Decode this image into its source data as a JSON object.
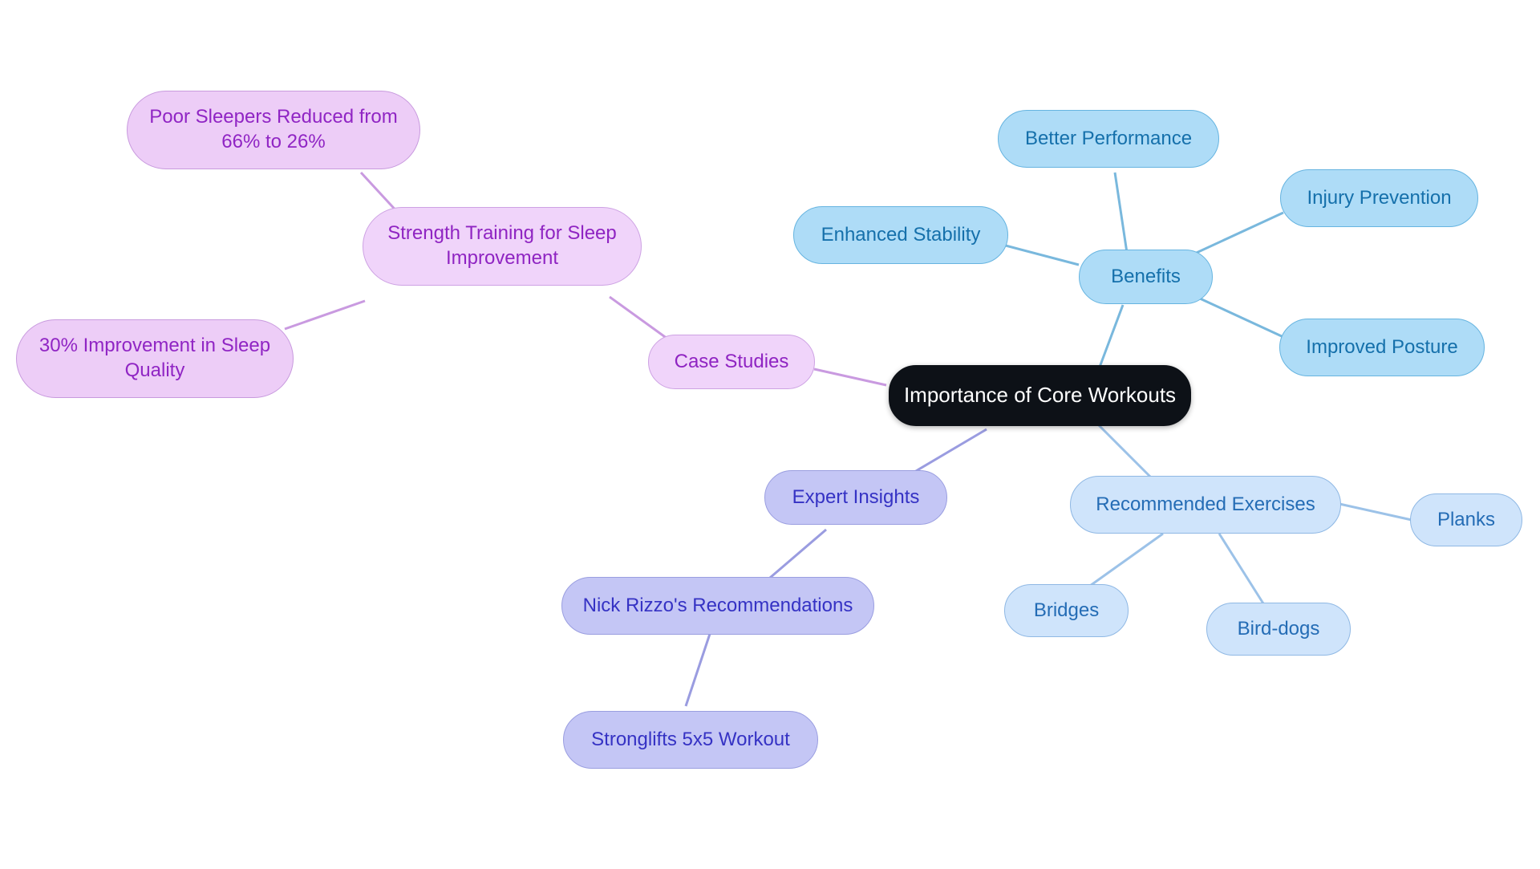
{
  "diagram": {
    "type": "mindmap",
    "title": "Importance of Core Workouts",
    "background": "#ffffff"
  },
  "palette": {
    "root_fill": "#0d1117",
    "root_text": "#ffffff",
    "purple_fill": "#edcdf7",
    "purple_text": "#9025c4",
    "blue_fill": "#aedcf7",
    "blue_text": "#1570ab",
    "blue_pale_fill": "#cfe4fb",
    "blue_pale_text": "#246cb5",
    "indigo_fill": "#c4c6f5",
    "indigo_text": "#3532c4",
    "edge_purple": "#c99ae0",
    "edge_blue": "#79b8dd",
    "edge_blue_pale": "#9cc2e8",
    "edge_indigo": "#9a9ce0"
  },
  "nodes": {
    "root": {
      "label": "Importance of Core Workouts"
    },
    "benefits": {
      "label": "Benefits"
    },
    "better_performance": {
      "label": "Better Performance"
    },
    "enhanced_stability": {
      "label": "Enhanced Stability"
    },
    "injury_prevention": {
      "label": "Injury Prevention"
    },
    "improved_posture": {
      "label": "Improved Posture"
    },
    "recommended_exercises": {
      "label": "Recommended Exercises"
    },
    "planks": {
      "label": "Planks"
    },
    "bridges": {
      "label": "Bridges"
    },
    "bird_dogs": {
      "label": "Bird-dogs"
    },
    "expert_insights": {
      "label": "Expert Insights"
    },
    "nick_rizzo": {
      "label": "Nick Rizzo's Recommendations"
    },
    "stronglifts": {
      "label": "Stronglifts 5x5 Workout"
    },
    "case_studies": {
      "label": "Case Studies"
    },
    "strength_training": {
      "label": "Strength Training for Sleep\nImprovement"
    },
    "poor_sleepers": {
      "label": "Poor Sleepers Reduced from\n66% to 26%"
    },
    "sleep_quality": {
      "label": "30% Improvement in Sleep\nQuality"
    }
  },
  "edges": [
    {
      "from": "root",
      "to": "benefits",
      "color": "#79b8dd"
    },
    {
      "from": "benefits",
      "to": "better_performance",
      "color": "#79b8dd"
    },
    {
      "from": "benefits",
      "to": "enhanced_stability",
      "color": "#79b8dd"
    },
    {
      "from": "benefits",
      "to": "injury_prevention",
      "color": "#79b8dd"
    },
    {
      "from": "benefits",
      "to": "improved_posture",
      "color": "#79b8dd"
    },
    {
      "from": "root",
      "to": "recommended_exercises",
      "color": "#9cc2e8"
    },
    {
      "from": "recommended_exercises",
      "to": "planks",
      "color": "#9cc2e8"
    },
    {
      "from": "recommended_exercises",
      "to": "bridges",
      "color": "#9cc2e8"
    },
    {
      "from": "recommended_exercises",
      "to": "bird_dogs",
      "color": "#9cc2e8"
    },
    {
      "from": "root",
      "to": "expert_insights",
      "color": "#9a9ce0"
    },
    {
      "from": "expert_insights",
      "to": "nick_rizzo",
      "color": "#9a9ce0"
    },
    {
      "from": "nick_rizzo",
      "to": "stronglifts",
      "color": "#9a9ce0"
    },
    {
      "from": "root",
      "to": "case_studies",
      "color": "#c99ae0"
    },
    {
      "from": "case_studies",
      "to": "strength_training",
      "color": "#c99ae0"
    },
    {
      "from": "strength_training",
      "to": "poor_sleepers",
      "color": "#c99ae0"
    },
    {
      "from": "strength_training",
      "to": "sleep_quality",
      "color": "#c99ae0"
    }
  ]
}
